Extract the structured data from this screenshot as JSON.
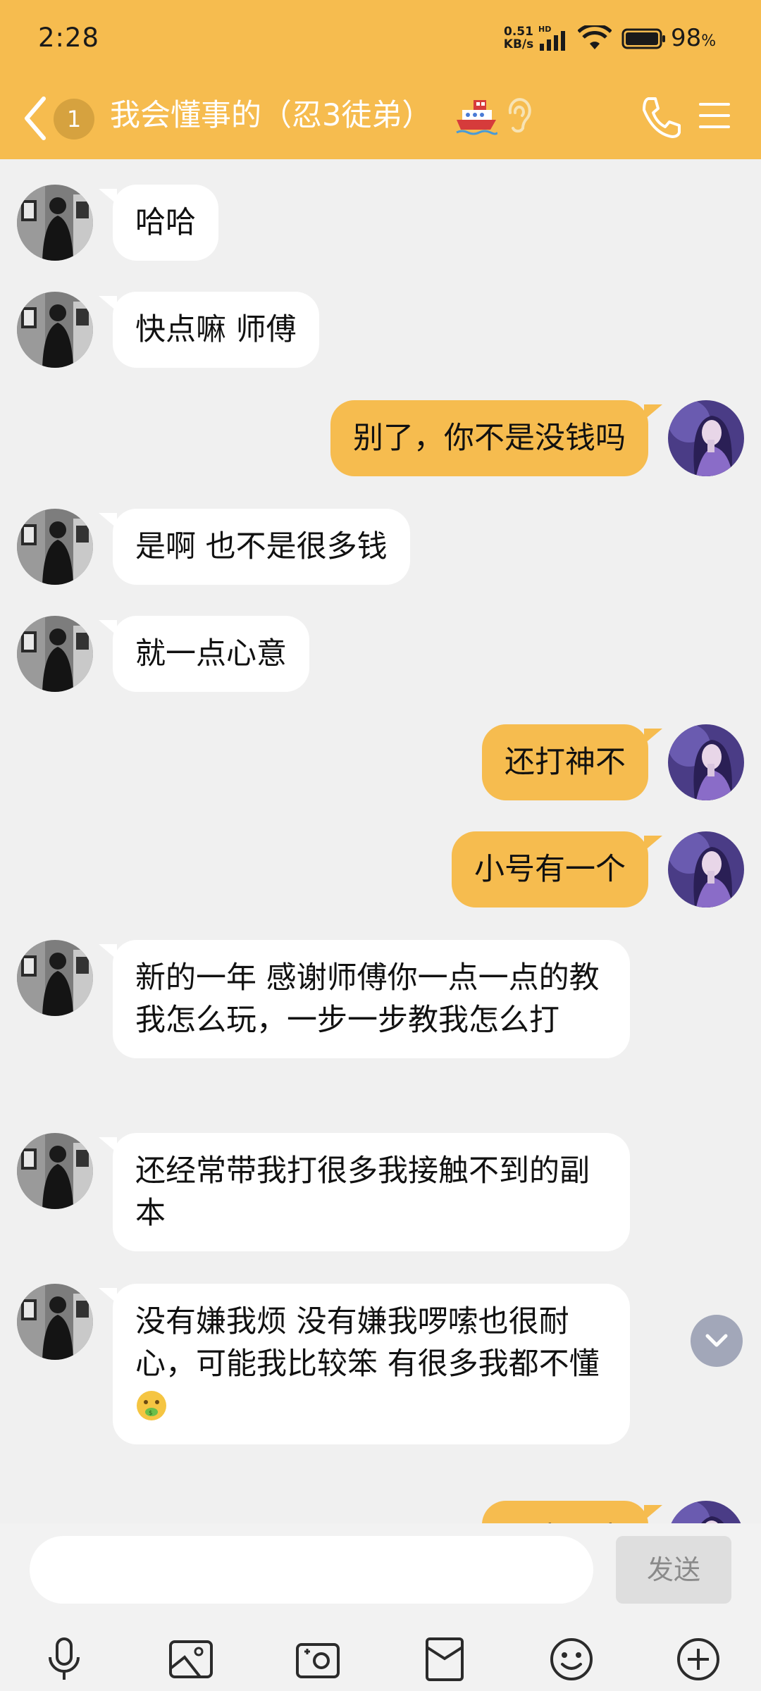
{
  "status_bar": {
    "time": "2:28",
    "net_speed_value": "0.51",
    "net_speed_unit": "KB/s",
    "network_badge": "HD",
    "battery_percent": "98",
    "battery_unit": "%"
  },
  "header": {
    "unread_count": "1",
    "title": "我会懂事的（忍3徒弟）",
    "icons": [
      "back-arrow-icon",
      "ship-icon",
      "ear-icon",
      "phone-icon",
      "menu-icon"
    ]
  },
  "messages": [
    {
      "side": "left",
      "text": "哈哈"
    },
    {
      "side": "left",
      "text": "快点嘛 师傅"
    },
    {
      "side": "right",
      "text": "别了，你不是没钱吗"
    },
    {
      "side": "left",
      "text": "是啊 也不是很多钱"
    },
    {
      "side": "left",
      "text": "就一点心意"
    },
    {
      "side": "right",
      "text": "还打神不"
    },
    {
      "side": "right",
      "text": "小号有一个"
    },
    {
      "side": "left",
      "text": "新的一年 感谢师傅你一点一点的教我怎么玩，一步一步教我怎么打"
    },
    {
      "side": "left",
      "text": "还经常带我打很多我接触不到的副本"
    },
    {
      "side": "left",
      "text": "没有嫌我烦 没有嫌我啰嗦也很耐心，可能我比较笨 有很多我都不懂",
      "emoji": "money-mouth-emoji"
    },
    {
      "side": "right",
      "text": "没事没事"
    }
  ],
  "composer": {
    "input_value": "",
    "send_label": "发送",
    "toolbar_icons": [
      "microphone-icon",
      "image-icon",
      "camera-icon",
      "red-packet-icon",
      "emoji-icon",
      "plus-icon"
    ]
  },
  "colors": {
    "accent": "#f6bc4f",
    "background": "#f0f0f0",
    "incoming_bubble": "#ffffff",
    "outgoing_bubble": "#f6bc4f"
  }
}
